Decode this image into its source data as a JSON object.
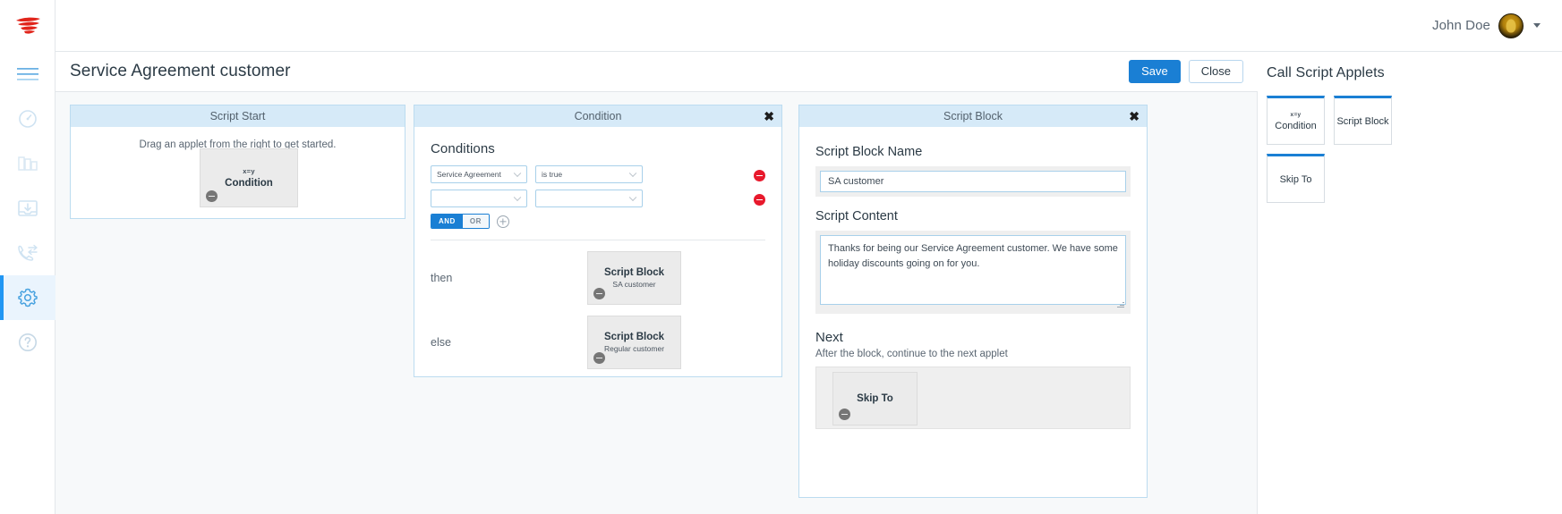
{
  "app": {
    "logo_icon": "flame-logo-icon",
    "rail_items": [
      {
        "name": "menu-icon",
        "label": "Menu"
      },
      {
        "name": "dashboard-icon",
        "label": "Dashboard"
      },
      {
        "name": "campaigns-icon",
        "label": "Campaigns"
      },
      {
        "name": "inbox-icon",
        "label": "Inbox"
      },
      {
        "name": "call-transfer-icon",
        "label": "Calls"
      },
      {
        "name": "gear-icon",
        "label": "Settings",
        "active": true
      },
      {
        "name": "help-icon",
        "label": "Help"
      }
    ]
  },
  "topbar": {
    "user_name": "John Doe",
    "avatar_icon": "user-avatar",
    "caret_icon": "chevron-down-icon"
  },
  "page_header": {
    "title": "Service Agreement customer",
    "save_label": "Save",
    "close_label": "Close"
  },
  "script_start": {
    "header": "Script Start",
    "hint": "Drag an applet from the right to get started.",
    "tile": {
      "icon_text": "x=y",
      "title": "Condition",
      "remove_icon": "minus-circle-icon"
    }
  },
  "condition_panel": {
    "header": "Condition",
    "close_icon": "close-icon",
    "section_title": "Conditions",
    "rows": [
      {
        "field_value": "Service Agreement",
        "operator_value": "is true",
        "remove_icon": "remove-condition-icon"
      },
      {
        "field_value": "",
        "operator_value": "",
        "remove_icon": "remove-condition-icon"
      }
    ],
    "logic": {
      "and_label": "AND",
      "or_label": "OR",
      "selected": "AND",
      "add_icon": "plus-circle-icon"
    },
    "branches": [
      {
        "label": "then",
        "tile": {
          "title": "Script Block",
          "desc": "SA customer",
          "remove_icon": "minus-circle-icon"
        }
      },
      {
        "label": "else",
        "tile": {
          "title": "Script Block",
          "desc": "Regular customer",
          "remove_icon": "minus-circle-icon"
        }
      }
    ]
  },
  "script_block_panel": {
    "header": "Script Block",
    "close_icon": "close-icon",
    "name_label": "Script Block Name",
    "name_value": "SA customer",
    "name_placeholder": "Script Block Name",
    "content_label": "Script Content",
    "content_value": "Thanks for being our Service Agreement customer. We have some holiday discounts going on for you.",
    "content_placeholder": "Script Content",
    "next_label": "Next",
    "next_sub": "After the block, continue to the next applet",
    "next_tile": {
      "title": "Skip To",
      "remove_icon": "minus-circle-icon"
    }
  },
  "right_sidebar": {
    "title": "Call Script Applets",
    "applets": [
      {
        "icon_text": "x=y",
        "label": "Condition"
      },
      {
        "icon_text": "",
        "label": "Script Block"
      },
      {
        "icon_text": "",
        "label": "Skip To"
      }
    ]
  },
  "colors": {
    "accent_blue": "#1a7fd4",
    "panel_header_blue": "#d6eaf8",
    "remove_red": "#e8192c",
    "logo_red": "#e1251b",
    "canvas_bg": "#f7f9fa"
  }
}
